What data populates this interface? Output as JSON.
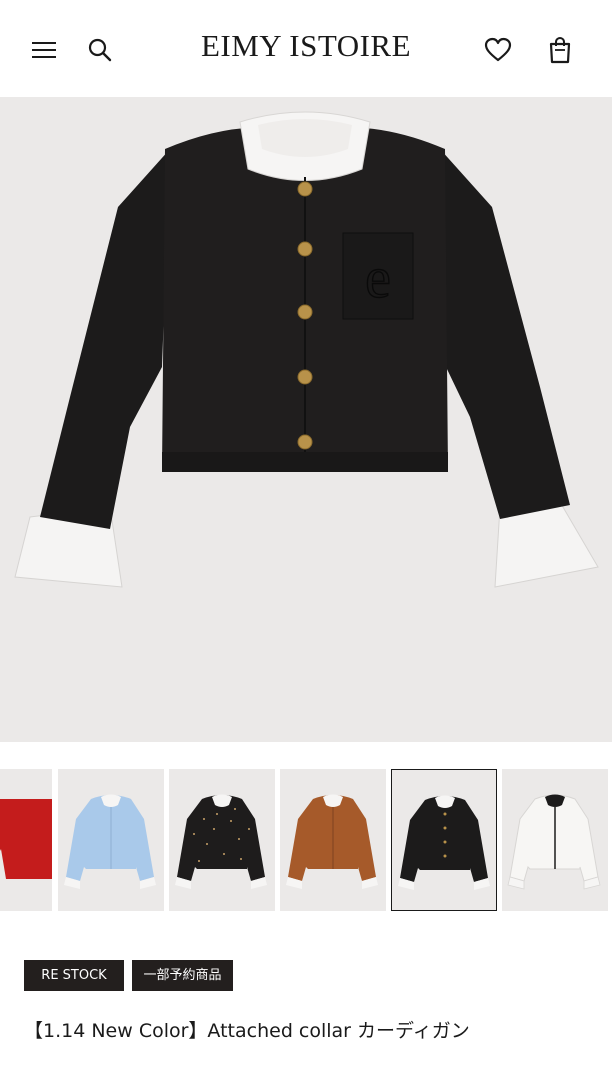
{
  "header": {
    "brand": "EIMY ISTOIRE",
    "icons": [
      "menu-icon",
      "search-icon",
      "heart-icon",
      "shopping-bag-icon"
    ]
  },
  "product": {
    "main_image": "black cardigan with white attached collar and cuffs",
    "thumbnails": [
      {
        "color": "red",
        "selected": false
      },
      {
        "color": "light blue",
        "selected": false
      },
      {
        "color": "black with dots",
        "selected": false
      },
      {
        "color": "brown",
        "selected": false
      },
      {
        "color": "black",
        "selected": true
      },
      {
        "color": "white",
        "selected": false
      }
    ],
    "badges": [
      "RE STOCK",
      "一部予約商品"
    ],
    "title": "【1.14 New Color】Attached collar カーディガン"
  },
  "colors": {
    "background": "#ebe9e8",
    "badge": "#231f1e",
    "text": "#1a1a1a"
  }
}
